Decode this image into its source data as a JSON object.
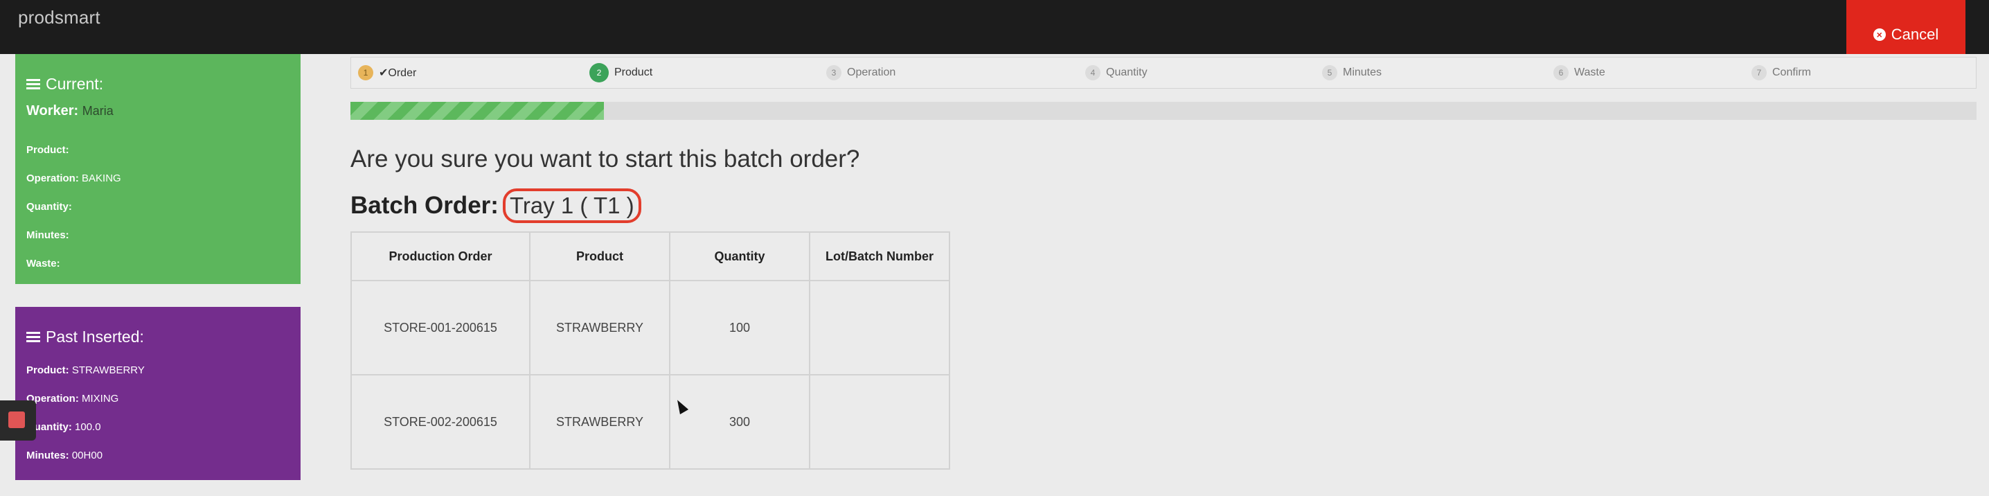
{
  "app": {
    "brand": "prodsmart",
    "cancel_label": "Cancel"
  },
  "current_panel": {
    "title": "Current:",
    "worker_label": "Worker:",
    "worker_value": "Maria",
    "fields": [
      {
        "label": "Product:",
        "value": ""
      },
      {
        "label": "Operation:",
        "value": "BAKING"
      },
      {
        "label": "Quantity:",
        "value": ""
      },
      {
        "label": "Minutes:",
        "value": ""
      },
      {
        "label": "Waste:",
        "value": ""
      }
    ]
  },
  "past_panel": {
    "title": "Past Inserted:",
    "fields": [
      {
        "label": "Product:",
        "value": "STRAWBERRY"
      },
      {
        "label": "Operation:",
        "value": "MIXING"
      },
      {
        "label": "Quantity:",
        "value": "100.0"
      },
      {
        "label": "Minutes:",
        "value": "00H00"
      }
    ]
  },
  "steps": [
    {
      "num": "1",
      "label": "✔Order",
      "state": "done"
    },
    {
      "num": "2",
      "label": "Product",
      "state": "active"
    },
    {
      "num": "3",
      "label": "Operation",
      "state": "todo"
    },
    {
      "num": "4",
      "label": "Quantity",
      "state": "todo"
    },
    {
      "num": "5",
      "label": "Minutes",
      "state": "todo"
    },
    {
      "num": "6",
      "label": "Waste",
      "state": "todo"
    },
    {
      "num": "7",
      "label": "Confirm",
      "state": "todo"
    }
  ],
  "progress_fraction": 0.156,
  "question": "Are you sure you want to start this batch order?",
  "batch": {
    "label": "Batch Order:",
    "value": "Tray 1 ( T1 )"
  },
  "table": {
    "headers": [
      "Production Order",
      "Product",
      "Quantity",
      "Lot/Batch Number"
    ],
    "rows": [
      [
        "STORE-001-200615",
        "STRAWBERRY",
        "100",
        ""
      ],
      [
        "STORE-002-200615",
        "STRAWBERRY",
        "300",
        ""
      ]
    ]
  },
  "colors": {
    "green": "#5cb65c",
    "purple": "#742d8d",
    "cancel_red": "#e0261c",
    "highlight_red": "#e23d2c"
  }
}
